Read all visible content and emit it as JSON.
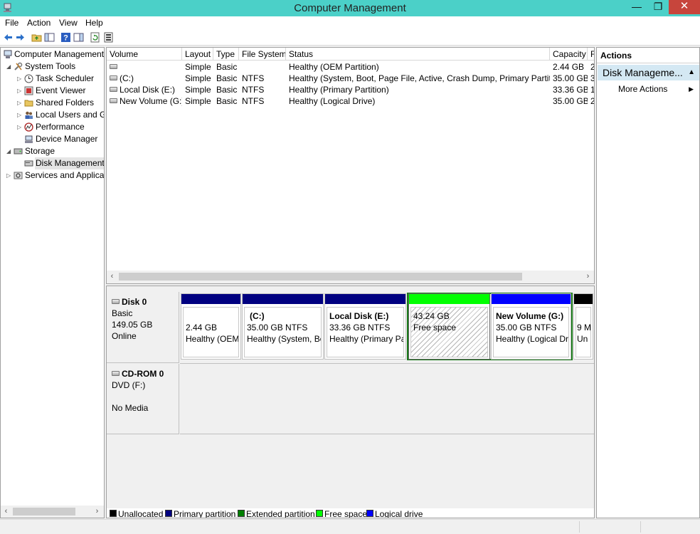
{
  "window": {
    "title": "Computer Management",
    "min": "—",
    "max": "❐",
    "close": "✕"
  },
  "menu": [
    "File",
    "Action",
    "View",
    "Help"
  ],
  "tree": {
    "items": [
      {
        "label": "Computer Management",
        "icon": "computer-management-icon"
      },
      {
        "label": "System Tools",
        "icon": "tools-icon"
      },
      {
        "label": "Task Scheduler",
        "icon": "clock-icon"
      },
      {
        "label": "Event Viewer",
        "icon": "event-viewer-icon"
      },
      {
        "label": "Shared Folders",
        "icon": "shared-folder-icon"
      },
      {
        "label": "Local Users and Gr",
        "icon": "users-icon"
      },
      {
        "label": "Performance",
        "icon": "performance-icon"
      },
      {
        "label": "Device Manager",
        "icon": "device-manager-icon"
      },
      {
        "label": "Storage",
        "icon": "storage-icon"
      },
      {
        "label": "Disk Management",
        "icon": "disk-management-icon"
      },
      {
        "label": "Services and Applicat",
        "icon": "services-icon"
      }
    ]
  },
  "volumes": {
    "columns": [
      "Volume",
      "Layout",
      "Type",
      "File System",
      "Status",
      "Capacity",
      "F"
    ],
    "rows": [
      {
        "volume": "",
        "layout": "Simple",
        "type": "Basic",
        "fs": "",
        "status": "Healthy (OEM Partition)",
        "capacity": "2.44 GB",
        "free": "2"
      },
      {
        "volume": "(C:)",
        "layout": "Simple",
        "type": "Basic",
        "fs": "NTFS",
        "status": "Healthy (System, Boot, Page File, Active, Crash Dump, Primary Partition)",
        "capacity": "35.00 GB",
        "free": "3"
      },
      {
        "volume": "Local Disk (E:)",
        "layout": "Simple",
        "type": "Basic",
        "fs": "NTFS",
        "status": "Healthy (Primary Partition)",
        "capacity": "33.36 GB",
        "free": "1"
      },
      {
        "volume": "New Volume (G:)",
        "layout": "Simple",
        "type": "Basic",
        "fs": "NTFS",
        "status": "Healthy (Logical Drive)",
        "capacity": "35.00 GB",
        "free": "2"
      }
    ]
  },
  "disks": [
    {
      "name": "Disk 0",
      "line1": "Basic",
      "line2": "149.05 GB",
      "line3": "Online",
      "partitions": [
        {
          "name": "",
          "size": "2.44 GB",
          "status": "Healthy (OEM",
          "color": "#000080"
        },
        {
          "name": "(C:)",
          "size": "35.00 GB NTFS",
          "status": "Healthy (System, Boo",
          "color": "#000080"
        },
        {
          "name": "Local Disk  (E:)",
          "size": "33.36 GB NTFS",
          "status": "Healthy (Primary Par",
          "color": "#000080"
        },
        {
          "name": "",
          "size": "43.24 GB",
          "status": "Free space",
          "color": "#00ff00"
        },
        {
          "name": "New Volume  (G:)",
          "size": "35.00 GB NTFS",
          "status": "Healthy (Logical Dri",
          "color": "#0000ff"
        },
        {
          "name": "",
          "size": "9 M",
          "status": "Un",
          "color": "#000000"
        }
      ]
    },
    {
      "name": "CD-ROM 0",
      "line1": "DVD (F:)",
      "line2": "",
      "line3": "No Media"
    }
  ],
  "legend": [
    {
      "label": "Unallocated",
      "color": "#000000"
    },
    {
      "label": "Primary partition",
      "color": "#000080"
    },
    {
      "label": "Extended partition",
      "color": "#008000"
    },
    {
      "label": "Free space",
      "color": "#00ff00"
    },
    {
      "label": "Logical drive",
      "color": "#0000ff"
    }
  ],
  "actions": {
    "header": "Actions",
    "section": "Disk Manageme...",
    "items": [
      "More Actions"
    ]
  }
}
